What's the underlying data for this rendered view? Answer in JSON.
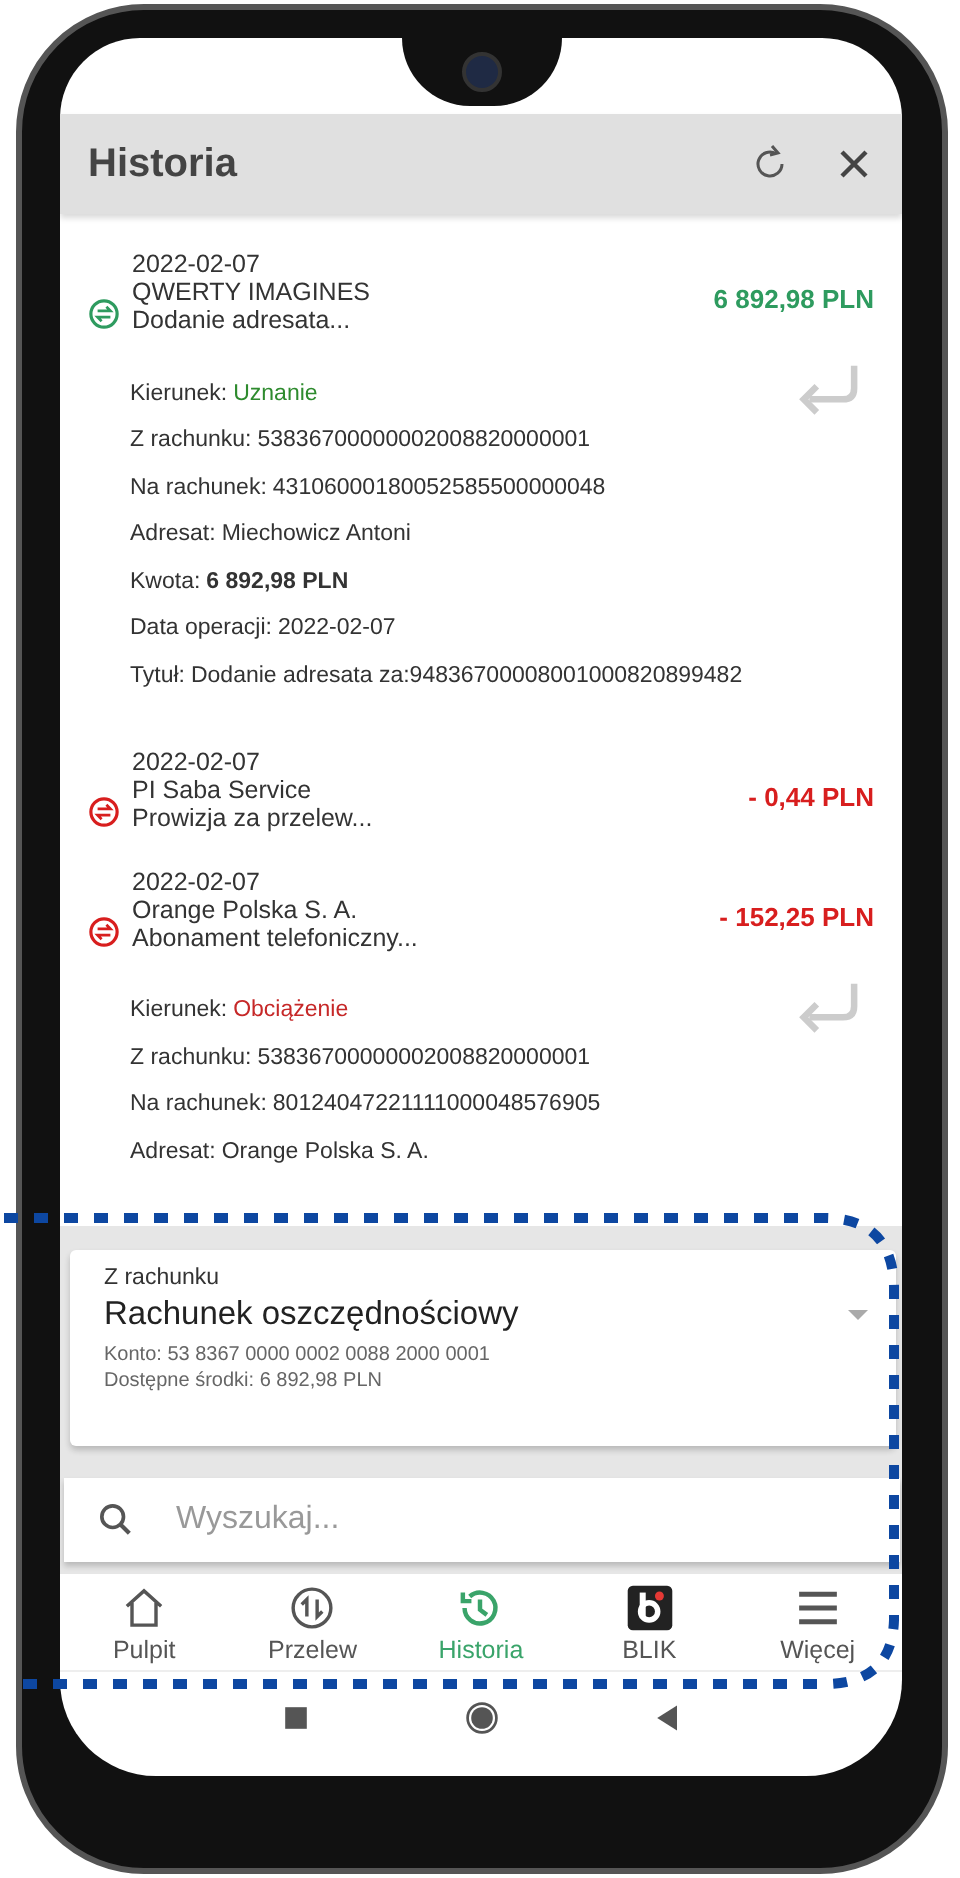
{
  "header": {
    "title": "Historia"
  },
  "transactions": [
    {
      "kind": "credit",
      "date": "2022-02-07",
      "name": "QWERTY IMAGINES",
      "description": "Dodanie adresata...",
      "amount": "6 892,98 PLN",
      "details": [
        {
          "kind": "direction",
          "label": "Kierunek:",
          "value": "Uznanie"
        },
        {
          "kind": "plain",
          "label": "Z rachunku:",
          "value": "53836700000002008820000001"
        },
        {
          "kind": "plain",
          "label": "Na rachunek:",
          "value": "43106000180052585500000048"
        },
        {
          "kind": "plain",
          "label": "Adresat:",
          "value": "Miechowicz Antoni"
        },
        {
          "kind": "amount",
          "label": "Kwota:",
          "value": "6 892,98 PLN"
        },
        {
          "kind": "plain",
          "label": "Data operacji:",
          "value": "2022-02-07"
        },
        {
          "kind": "plain",
          "label": "Tytuł:",
          "value": "Dodanie adresata za:94836700008001000820899482"
        }
      ]
    },
    {
      "kind": "debit",
      "date": "2022-02-07",
      "name": "PI Saba Service",
      "description": "Prowizja za przelew...",
      "amount": "- 0,44 PLN"
    },
    {
      "kind": "debit",
      "date": "2022-02-07",
      "name": "Orange Polska S. A.",
      "description": "Abonament telefoniczny...",
      "amount": "- 152,25 PLN",
      "details": [
        {
          "kind": "direction",
          "label": "Kierunek:",
          "value": "Obciążenie"
        },
        {
          "kind": "plain",
          "label": "Z rachunku:",
          "value": "53836700000002008820000001"
        },
        {
          "kind": "plain",
          "label": "Na rachunek:",
          "value": "80124047221111000048576905"
        },
        {
          "kind": "plain",
          "label": "Adresat:",
          "value": "Orange Polska S. A."
        }
      ]
    }
  ],
  "account": {
    "label": "Z rachunku",
    "name": "Rachunek oszczędnościowy",
    "number": "Konto: 53 8367 0000 0002 0088 2000 0001",
    "balance": "Dostępne środki: 6 892,98 PLN"
  },
  "search": {
    "placeholder": "Wyszukaj..."
  },
  "nav": [
    {
      "kind": "home",
      "label": "Pulpit",
      "selected": false
    },
    {
      "kind": "transfer",
      "label": "Przelew",
      "selected": false
    },
    {
      "kind": "history",
      "label": "Historia",
      "selected": true
    },
    {
      "kind": "blik",
      "label": "BLIK",
      "selected": false
    },
    {
      "kind": "menu",
      "label": "Więcej",
      "selected": false
    }
  ]
}
